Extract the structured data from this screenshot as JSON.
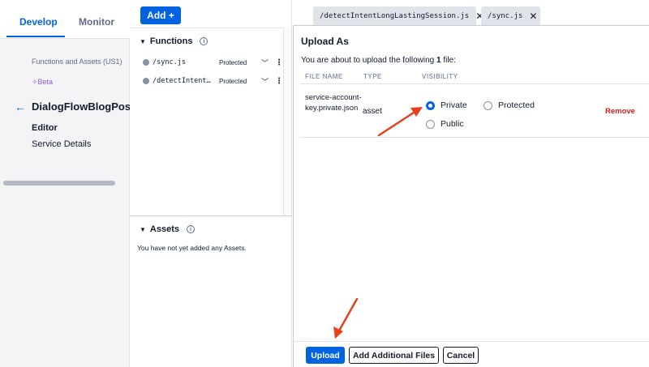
{
  "nav": {
    "tabs": [
      "Develop",
      "Monitor"
    ],
    "service_sub": "Functions and Assets (US1)",
    "beta": "Beta",
    "service_name": "DialogFlowBlogPostTo",
    "items": [
      "Editor",
      "Service Details"
    ]
  },
  "toolbar": {
    "add_label": "Add",
    "add_icon": "+"
  },
  "functions": {
    "heading": "Functions",
    "rows": [
      {
        "path": "/sync.js",
        "visibility": "Protected"
      },
      {
        "path": "/detectIntent…",
        "visibility": "Protected"
      }
    ]
  },
  "assets": {
    "heading": "Assets",
    "empty": "You have not yet added any Assets."
  },
  "editor_tabs": [
    {
      "label": "/detectIntentLongLastingSession.js"
    },
    {
      "label": "/sync.js"
    }
  ],
  "dialog": {
    "title": "Upload As",
    "desc_prefix": "You are about to upload the following",
    "count": "1",
    "desc_suffix": "file:",
    "columns": [
      "FILE NAME",
      "TYPE",
      "VISIBILITY"
    ],
    "file": {
      "name": "service-account-key.private.json",
      "type": "asset",
      "options": [
        "Private",
        "Protected",
        "Public"
      ],
      "selected": "Private",
      "remove_label": "Remove"
    },
    "buttons": {
      "upload": "Upload",
      "add_files": "Add Additional Files",
      "cancel": "Cancel"
    }
  },
  "colors": {
    "accent": "#0263e0",
    "danger": "#d61f1f",
    "annotation": "#e8401c"
  }
}
